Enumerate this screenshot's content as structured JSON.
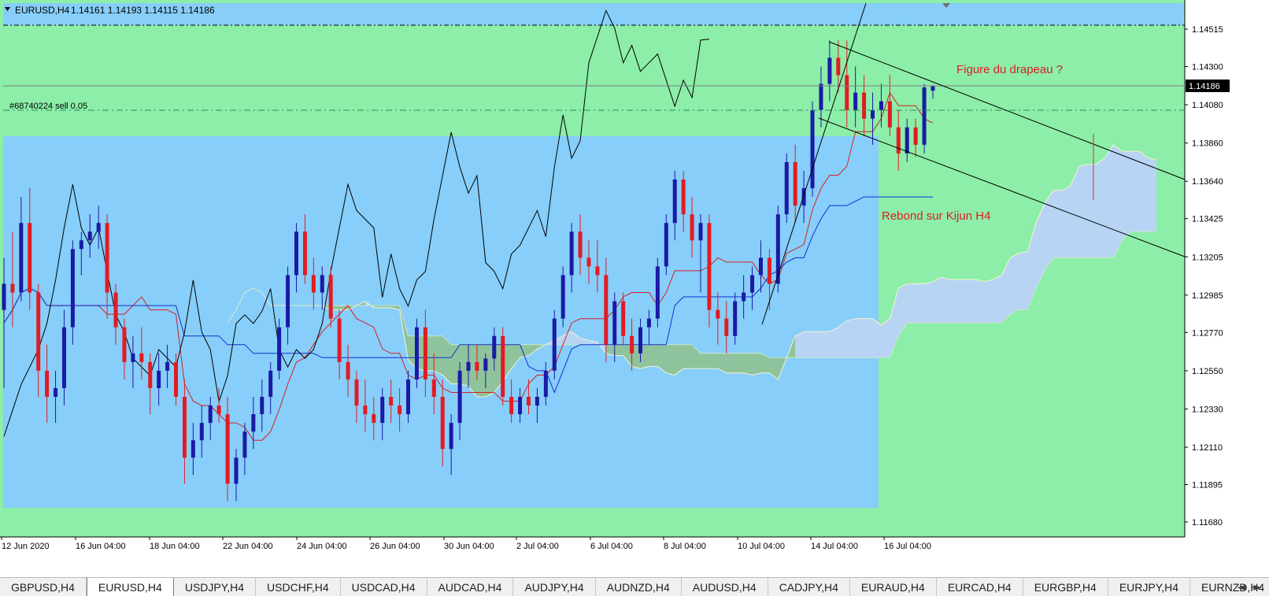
{
  "header": {
    "symbol": "EURUSD,H4",
    "ohlc": "1.14161 1.14193 1.14115 1.14186"
  },
  "order_label": "#68740224 sell 0.05",
  "annotations": {
    "flag": "Figure du drapeau ?",
    "kijun": "Rebond sur Kijun H4"
  },
  "chart_data": {
    "type": "candlestick",
    "title": "EURUSD,H4",
    "y_ticks": [
      1.14515,
      1.143,
      1.1408,
      1.1386,
      1.1364,
      1.13425,
      1.13205,
      1.12985,
      1.1277,
      1.1255,
      1.1233,
      1.1211,
      1.11895,
      1.1168
    ],
    "current_price": 1.14186,
    "x_ticks": [
      "12 Jun 2020",
      "16 Jun 04:00",
      "18 Jun 04:00",
      "22 Jun 04:00",
      "24 Jun 04:00",
      "26 Jun 04:00",
      "30 Jun 04:00",
      "2 Jul 04:00",
      "6 Jul 04:00",
      "8 Jul 04:00",
      "10 Jul 04:00",
      "14 Jul 04:00",
      "16 Jul 04:00"
    ],
    "ohlc_series": [
      [
        1.129,
        1.132,
        1.1245,
        1.1305
      ],
      [
        1.1305,
        1.1335,
        1.128,
        1.13
      ],
      [
        1.13,
        1.1355,
        1.1295,
        1.134
      ],
      [
        1.134,
        1.136,
        1.129,
        1.13
      ],
      [
        1.13,
        1.1305,
        1.124,
        1.1255
      ],
      [
        1.1255,
        1.127,
        1.1225,
        1.124
      ],
      [
        1.124,
        1.1255,
        1.1225,
        1.1245
      ],
      [
        1.1245,
        1.129,
        1.1235,
        1.128
      ],
      [
        1.128,
        1.133,
        1.127,
        1.1325
      ],
      [
        1.1325,
        1.1335,
        1.131,
        1.133
      ],
      [
        1.133,
        1.1345,
        1.132,
        1.1335
      ],
      [
        1.1335,
        1.135,
        1.1325,
        1.134
      ],
      [
        1.134,
        1.1345,
        1.1285,
        1.13
      ],
      [
        1.13,
        1.1305,
        1.127,
        1.128
      ],
      [
        1.128,
        1.1285,
        1.125,
        1.126
      ],
      [
        1.126,
        1.1275,
        1.1245,
        1.1265
      ],
      [
        1.1265,
        1.128,
        1.125,
        1.126
      ],
      [
        1.126,
        1.1265,
        1.123,
        1.1245
      ],
      [
        1.1245,
        1.1265,
        1.1235,
        1.1255
      ],
      [
        1.1255,
        1.127,
        1.1245,
        1.126
      ],
      [
        1.126,
        1.1265,
        1.1235,
        1.124
      ],
      [
        1.124,
        1.125,
        1.119,
        1.1205
      ],
      [
        1.1205,
        1.1225,
        1.1195,
        1.1215
      ],
      [
        1.1215,
        1.1235,
        1.1205,
        1.1225
      ],
      [
        1.1225,
        1.124,
        1.1215,
        1.1235
      ],
      [
        1.1235,
        1.1245,
        1.1225,
        1.123
      ],
      [
        1.123,
        1.124,
        1.118,
        1.119
      ],
      [
        1.119,
        1.121,
        1.118,
        1.1205
      ],
      [
        1.1205,
        1.1225,
        1.1195,
        1.122
      ],
      [
        1.122,
        1.124,
        1.121,
        1.123
      ],
      [
        1.123,
        1.125,
        1.122,
        1.124
      ],
      [
        1.124,
        1.126,
        1.123,
        1.1255
      ],
      [
        1.1255,
        1.1285,
        1.125,
        1.128
      ],
      [
        1.128,
        1.1315,
        1.127,
        1.131
      ],
      [
        1.131,
        1.134,
        1.13,
        1.1335
      ],
      [
        1.1335,
        1.1345,
        1.1305,
        1.131
      ],
      [
        1.131,
        1.132,
        1.129,
        1.13
      ],
      [
        1.13,
        1.1315,
        1.129,
        1.131
      ],
      [
        1.131,
        1.1315,
        1.128,
        1.1285
      ],
      [
        1.1285,
        1.129,
        1.125,
        1.126
      ],
      [
        1.126,
        1.127,
        1.124,
        1.125
      ],
      [
        1.125,
        1.1255,
        1.1225,
        1.1235
      ],
      [
        1.1235,
        1.125,
        1.122,
        1.123
      ],
      [
        1.123,
        1.124,
        1.1215,
        1.1225
      ],
      [
        1.1225,
        1.1245,
        1.1215,
        1.124
      ],
      [
        1.124,
        1.125,
        1.1225,
        1.1235
      ],
      [
        1.1235,
        1.1245,
        1.122,
        1.123
      ],
      [
        1.123,
        1.1255,
        1.1225,
        1.125
      ],
      [
        1.125,
        1.1285,
        1.1245,
        1.128
      ],
      [
        1.128,
        1.129,
        1.124,
        1.125
      ],
      [
        1.125,
        1.1265,
        1.123,
        1.124
      ],
      [
        1.124,
        1.125,
        1.12,
        1.121
      ],
      [
        1.121,
        1.123,
        1.1195,
        1.1225
      ],
      [
        1.1225,
        1.126,
        1.1215,
        1.1255
      ],
      [
        1.1255,
        1.127,
        1.1245,
        1.126
      ],
      [
        1.126,
        1.127,
        1.125,
        1.1255
      ],
      [
        1.1255,
        1.1265,
        1.1245,
        1.1262
      ],
      [
        1.1262,
        1.128,
        1.1255,
        1.1275
      ],
      [
        1.1275,
        1.128,
        1.1235,
        1.124
      ],
      [
        1.124,
        1.125,
        1.1225,
        1.123
      ],
      [
        1.123,
        1.1245,
        1.1225,
        1.124
      ],
      [
        1.124,
        1.125,
        1.123,
        1.1235
      ],
      [
        1.1235,
        1.1245,
        1.1225,
        1.124
      ],
      [
        1.124,
        1.126,
        1.1235,
        1.1255
      ],
      [
        1.1255,
        1.129,
        1.125,
        1.1285
      ],
      [
        1.1285,
        1.1315,
        1.128,
        1.131
      ],
      [
        1.131,
        1.134,
        1.13,
        1.1335
      ],
      [
        1.1335,
        1.1345,
        1.131,
        1.132
      ],
      [
        1.132,
        1.133,
        1.1305,
        1.1315
      ],
      [
        1.1315,
        1.133,
        1.13,
        1.131
      ],
      [
        1.131,
        1.132,
        1.126,
        1.127
      ],
      [
        1.127,
        1.13,
        1.126,
        1.1295
      ],
      [
        1.1295,
        1.13,
        1.127,
        1.1275
      ],
      [
        1.1275,
        1.1285,
        1.1255,
        1.1265
      ],
      [
        1.1265,
        1.1285,
        1.126,
        1.128
      ],
      [
        1.128,
        1.129,
        1.127,
        1.1285
      ],
      [
        1.1285,
        1.132,
        1.128,
        1.1315
      ],
      [
        1.1315,
        1.1345,
        1.131,
        1.134
      ],
      [
        1.134,
        1.137,
        1.133,
        1.1365
      ],
      [
        1.1365,
        1.137,
        1.1335,
        1.1345
      ],
      [
        1.1345,
        1.1355,
        1.132,
        1.133
      ],
      [
        1.133,
        1.1345,
        1.13,
        1.134
      ],
      [
        1.134,
        1.1345,
        1.128,
        1.129
      ],
      [
        1.129,
        1.13,
        1.127,
        1.1285
      ],
      [
        1.1285,
        1.1295,
        1.1265,
        1.1275
      ],
      [
        1.1275,
        1.13,
        1.127,
        1.1295
      ],
      [
        1.1295,
        1.131,
        1.1285,
        1.13
      ],
      [
        1.13,
        1.1315,
        1.129,
        1.131
      ],
      [
        1.131,
        1.133,
        1.13,
        1.132
      ],
      [
        1.132,
        1.1325,
        1.129,
        1.1305
      ],
      [
        1.1305,
        1.135,
        1.13,
        1.1345
      ],
      [
        1.1345,
        1.138,
        1.134,
        1.1375
      ],
      [
        1.1375,
        1.1385,
        1.134,
        1.135
      ],
      [
        1.135,
        1.137,
        1.134,
        1.136
      ],
      [
        1.136,
        1.141,
        1.1355,
        1.1405
      ],
      [
        1.1405,
        1.143,
        1.1395,
        1.142
      ],
      [
        1.142,
        1.1445,
        1.141,
        1.1435
      ],
      [
        1.1435,
        1.1445,
        1.1415,
        1.1425
      ],
      [
        1.1425,
        1.1445,
        1.1395,
        1.1405
      ],
      [
        1.1405,
        1.143,
        1.1395,
        1.1415
      ],
      [
        1.1415,
        1.1425,
        1.139,
        1.14
      ],
      [
        1.14,
        1.1415,
        1.1385,
        1.1405
      ],
      [
        1.1405,
        1.142,
        1.1395,
        1.141
      ],
      [
        1.141,
        1.1425,
        1.139,
        1.1395
      ],
      [
        1.1395,
        1.1405,
        1.137,
        1.138
      ],
      [
        1.138,
        1.14,
        1.1375,
        1.1395
      ],
      [
        1.1395,
        1.14,
        1.1378,
        1.1385
      ],
      [
        1.1385,
        1.142,
        1.138,
        1.1418
      ],
      [
        1.14161,
        1.14193,
        1.14115,
        1.14186
      ]
    ],
    "legend": "none",
    "grid": false
  },
  "tabs": [
    "GBPUSD,H4",
    "EURUSD,H4",
    "USDJPY,H4",
    "USDCHF,H4",
    "USDCAD,H4",
    "AUDCAD,H4",
    "AUDJPY,H4",
    "AUDNZD,H4",
    "AUDUSD,H4",
    "CADJPY,H4",
    "EURAUD,H4",
    "EURCAD,H4",
    "EURGBP,H4",
    "EURJPY,H4",
    "EURNZD,H4"
  ],
  "active_tab": "EURUSD,H4",
  "colors": {
    "bull": "#1a1aa6",
    "bear": "#e21b23",
    "bg_blue": "#87cefa",
    "bg_green": "#8ceea8",
    "kumo_bull": "#b8d4f4",
    "kumo_bear": "#8fc39c"
  },
  "nav": {
    "left": "◄",
    "right": "►"
  }
}
